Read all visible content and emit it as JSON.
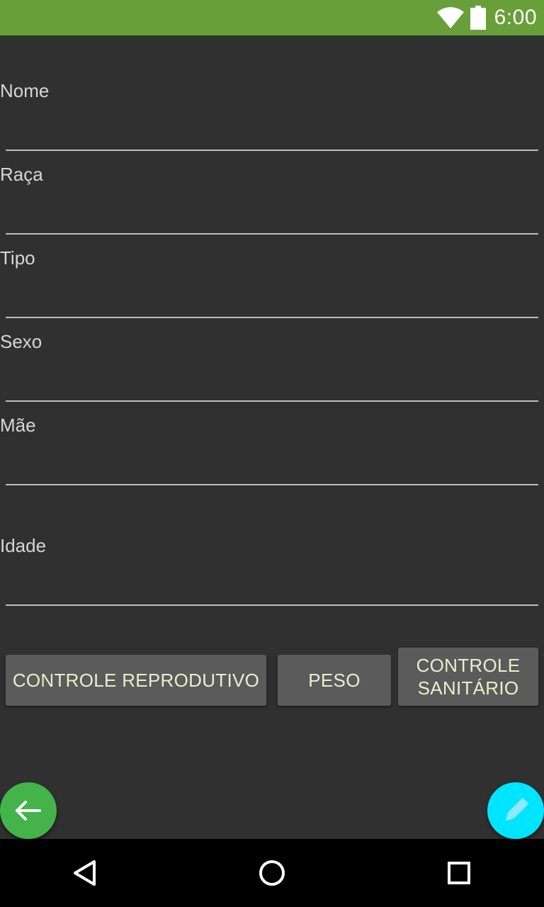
{
  "status_bar": {
    "time": "6:00",
    "icons": [
      "wifi-icon",
      "battery-icon"
    ],
    "color": "#689f38"
  },
  "form": {
    "fields": [
      {
        "label": "Nome",
        "value": ""
      },
      {
        "label": "Raça",
        "value": ""
      },
      {
        "label": "Tipo",
        "value": ""
      },
      {
        "label": "Sexo",
        "value": ""
      },
      {
        "label": "Mãe",
        "value": ""
      },
      {
        "label": "Idade",
        "value": ""
      }
    ]
  },
  "buttons": {
    "reprodutivo": "CONTROLE REPRODUTIVO",
    "peso": "PESO",
    "sanitario_line1": "CONTROLE",
    "sanitario_line2": "SANITÁRIO"
  },
  "fabs": {
    "back": {
      "icon": "arrow-left-icon",
      "color": "#43b34a"
    },
    "edit": {
      "icon": "pencil-icon",
      "color": "#00e5ff"
    }
  },
  "nav_bar": {
    "icons": [
      "back-triangle-icon",
      "home-circle-icon",
      "recents-square-icon"
    ]
  }
}
